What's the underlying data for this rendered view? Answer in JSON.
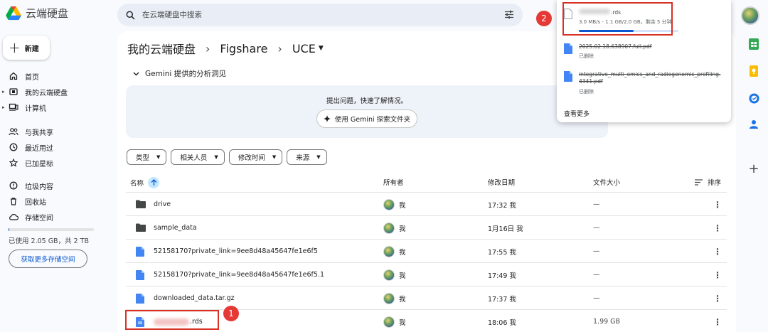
{
  "app": {
    "title": "云端硬盘"
  },
  "new_button": {
    "label": "新建"
  },
  "sidebar": {
    "items": [
      {
        "label": "首页",
        "icon": "home-icon"
      },
      {
        "label": "我的云端硬盘",
        "icon": "drive-icon"
      },
      {
        "label": "计算机",
        "icon": "computer-icon"
      },
      {
        "label": "与我共享",
        "icon": "people-icon"
      },
      {
        "label": "最近用过",
        "icon": "clock-icon"
      },
      {
        "label": "已加星标",
        "icon": "star-icon"
      },
      {
        "label": "垃圾内容",
        "icon": "spam-icon"
      },
      {
        "label": "回收站",
        "icon": "trash-icon"
      },
      {
        "label": "存储空间",
        "icon": "cloud-icon"
      }
    ],
    "storage_text": "已使用 2.05 GB，共 2 TB",
    "storage_used_fraction": 0.001,
    "more_storage_label": "获取更多存储空间"
  },
  "search": {
    "placeholder": "在云端硬盘中搜索"
  },
  "breadcrumb": [
    "我的云端硬盘",
    "Figshare",
    "UCE"
  ],
  "gemini": {
    "toggle_label": "Gemini 提供的分析洞见",
    "prompt": "提出问题，快速了解情况。",
    "button_label": "使用 Gemini 探索文件夹"
  },
  "filters": [
    "类型",
    "相关人员",
    "修改时间",
    "来源"
  ],
  "table": {
    "headers": {
      "name": "名称",
      "owner": "所有者",
      "modified": "修改日期",
      "size": "文件大小",
      "sort": "排序"
    },
    "rows": [
      {
        "type": "folder",
        "name": "drive",
        "owner": "我",
        "modified": "17:32 我",
        "size": "—"
      },
      {
        "type": "folder",
        "name": "sample_data",
        "owner": "我",
        "modified": "1月16日 我",
        "size": "—"
      },
      {
        "type": "file",
        "name": "52158170?private_link=9ee8d48a45647fe1e6f5",
        "owner": "我",
        "modified": "17:55 我",
        "size": "—"
      },
      {
        "type": "file",
        "name": "52158170?private_link=9ee8d48a45647fe1e6f5.1",
        "owner": "我",
        "modified": "17:49 我",
        "size": "—"
      },
      {
        "type": "file",
        "name": "downloaded_data.tar.gz",
        "owner": "我",
        "modified": "17:37 我",
        "size": "—"
      },
      {
        "type": "file",
        "name": ".rds",
        "owner": "我",
        "modified": "18:06 我",
        "size": "1.99 GB"
      }
    ]
  },
  "downloads": {
    "items": [
      {
        "name": ".rds",
        "status": "3.0 MB/s - 1.1 GB/2.0 GB，剩余 5 分钟",
        "deleted": false,
        "progress": 0.55
      },
      {
        "name": "2025.02.18.638907.full.pdf",
        "status": "已删除",
        "deleted": true
      },
      {
        "name": "integrative_multi_omics_and_radiogenomic_profiling.4341.pdf",
        "status": "已删除",
        "deleted": true
      }
    ],
    "see_more": "查看更多"
  },
  "annotations": {
    "one": "1",
    "two": "2"
  },
  "colors": {
    "accent": "#0b57d0",
    "annotation_red": "#d93025"
  }
}
